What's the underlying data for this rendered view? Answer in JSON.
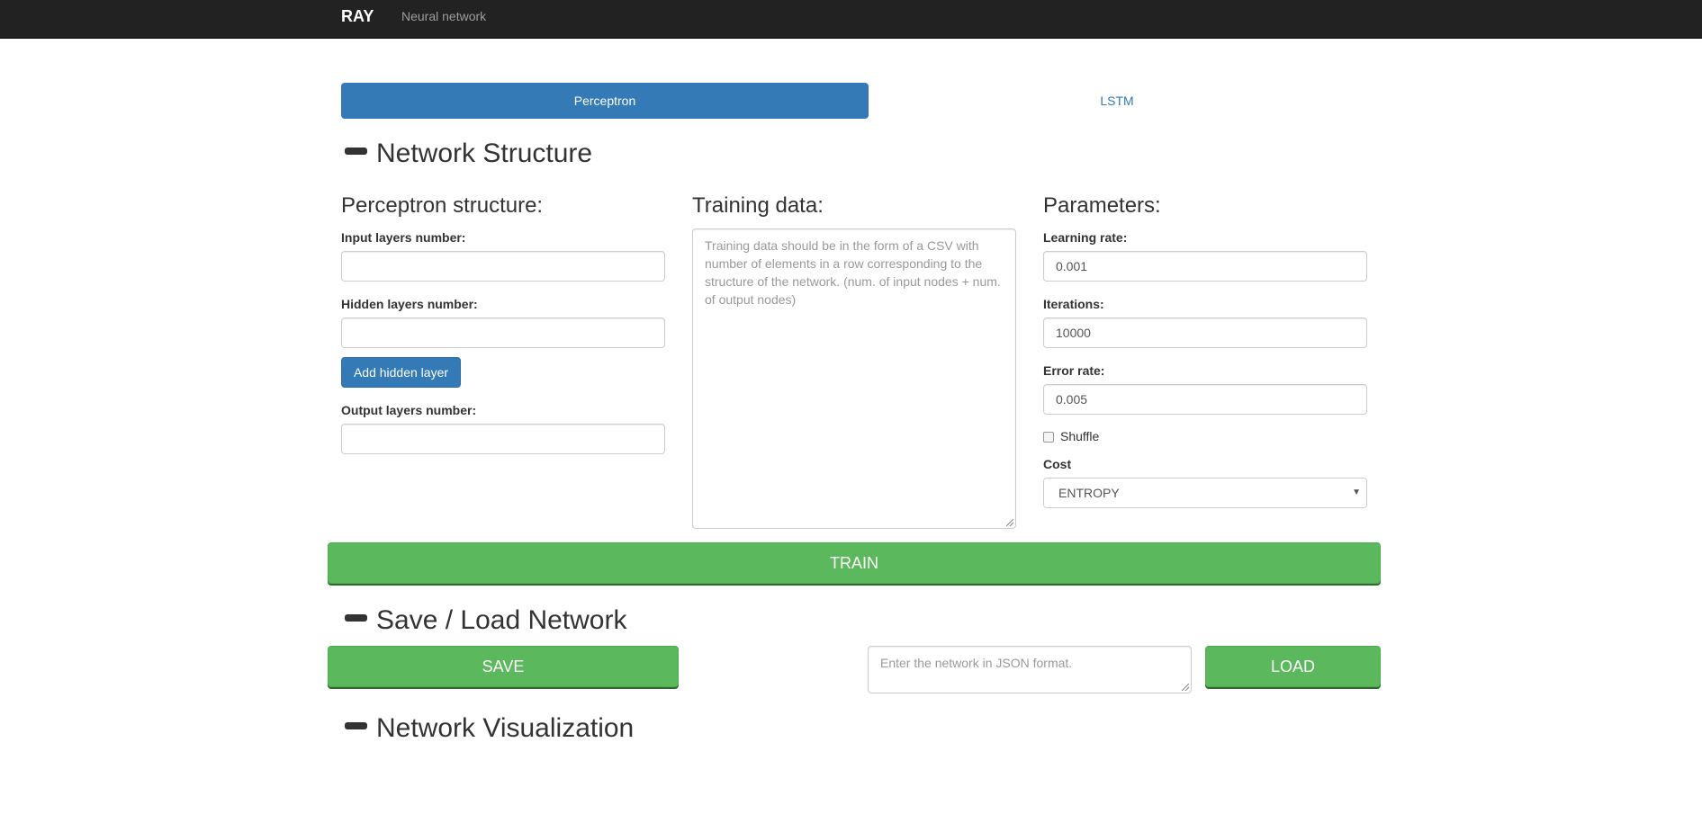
{
  "navbar": {
    "brand": "RAY",
    "link": "Neural network"
  },
  "tabs": [
    {
      "label": "Perceptron",
      "active": true
    },
    {
      "label": "LSTM",
      "active": false
    }
  ],
  "sections": {
    "structure": "Network Structure",
    "save_load": "Save / Load Network",
    "visualization": "Network Visualization"
  },
  "perceptron": {
    "title": "Perceptron structure:",
    "input_label": "Input layers number:",
    "input_value": "",
    "hidden_label": "Hidden layers number:",
    "hidden_value": "",
    "add_hidden_button": "Add hidden layer",
    "output_label": "Output layers number:",
    "output_value": ""
  },
  "training": {
    "title": "Training data:",
    "placeholder": "Training data should be in the form of a CSV with number of elements in a row corresponding to the structure of the network. (num. of input nodes + num. of output nodes)"
  },
  "parameters": {
    "title": "Parameters:",
    "learning_rate_label": "Learning rate:",
    "learning_rate_value": "0.001",
    "iterations_label": "Iterations:",
    "iterations_value": "10000",
    "error_rate_label": "Error rate:",
    "error_rate_value": "0.005",
    "shuffle_label": "Shuffle",
    "shuffle_checked": false,
    "cost_label": "Cost",
    "cost_value": "ENTROPY"
  },
  "actions": {
    "train": "TRAIN",
    "save": "SAVE",
    "load": "LOAD",
    "json_placeholder": "Enter the network in JSON format."
  },
  "colors": {
    "navbar": "#222222",
    "primary": "#337ab7",
    "success": "#5cb85c"
  }
}
